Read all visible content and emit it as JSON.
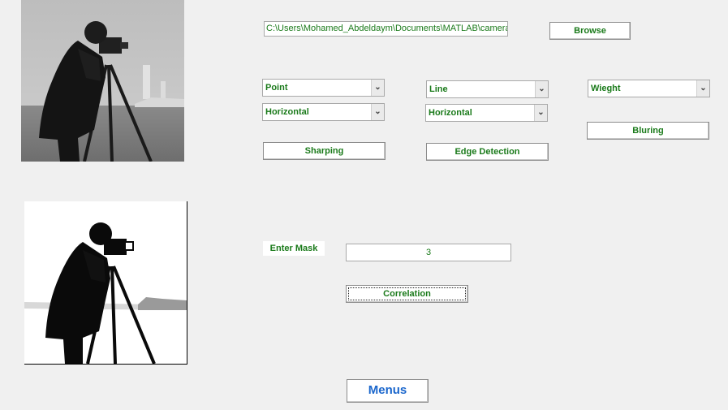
{
  "path": {
    "value": "C:\\Users\\Mohamed_Abdeldaym\\Documents\\MATLAB\\cameraman.tif"
  },
  "buttons": {
    "browse": "Browse",
    "sharping": "Sharping",
    "edge_detection": "Edge Detection",
    "bluring": "Bluring",
    "correlation": "Correlation",
    "menus": "Menus"
  },
  "dropdowns": {
    "sharp_type": "Point",
    "sharp_direction": "Horizontal",
    "edge_type": "Line",
    "edge_direction": "Horizontal",
    "blur_type": "Wieght"
  },
  "mask": {
    "label": "Enter Mask",
    "value": "3"
  },
  "images": {
    "original": "cameraman-original",
    "processed": "cameraman-processed"
  },
  "colors": {
    "text_green": "#1a7a1a",
    "menus_blue": "#1a66cc",
    "background": "#f0f0f0"
  }
}
